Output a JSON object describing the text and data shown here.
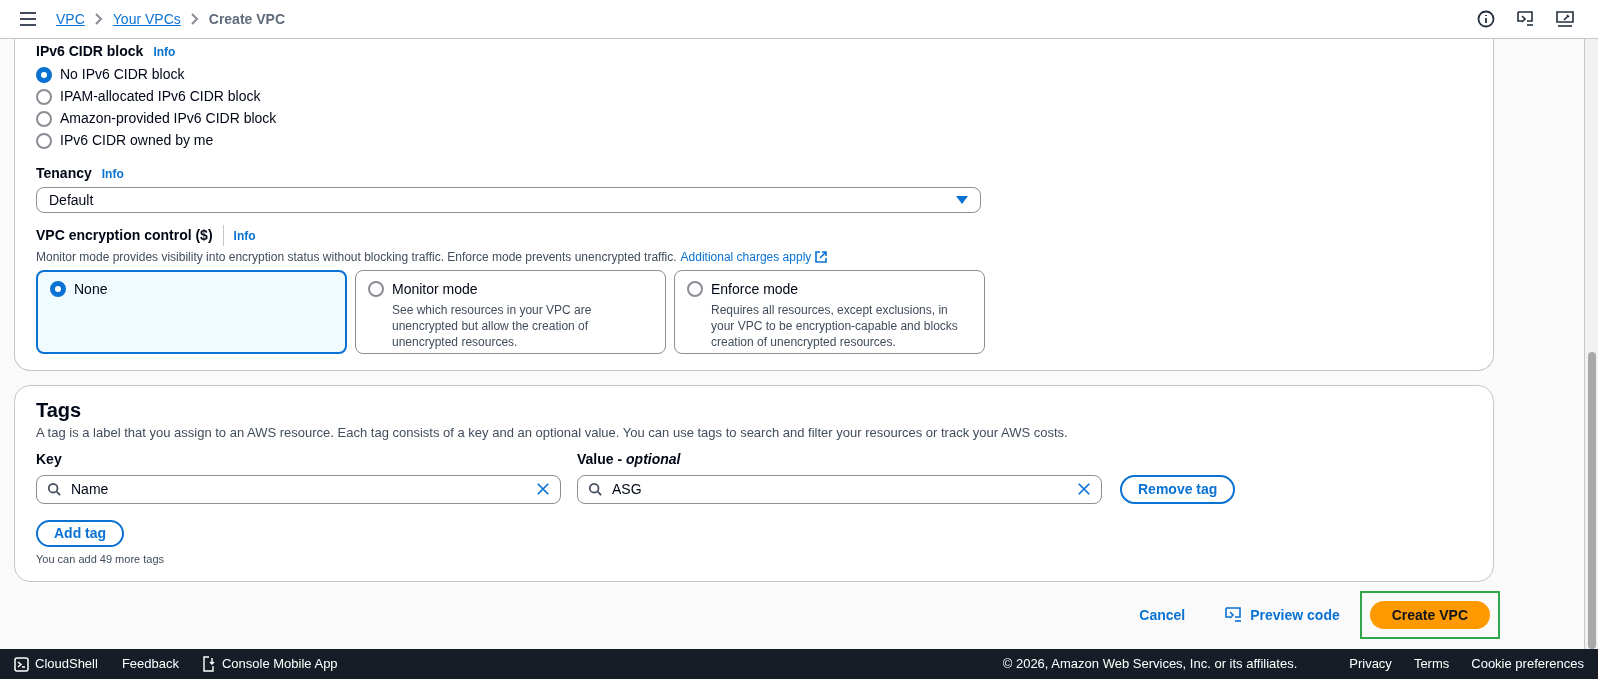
{
  "header": {
    "breadcrumbs": [
      {
        "label": "VPC",
        "kind": "link"
      },
      {
        "label": "Your VPCs",
        "kind": "link"
      },
      {
        "label": "Create VPC",
        "kind": "current"
      }
    ]
  },
  "ipv6": {
    "label": "IPv6 CIDR block",
    "info": "Info",
    "options": [
      {
        "label": "No IPv6 CIDR block",
        "selected": true
      },
      {
        "label": "IPAM-allocated IPv6 CIDR block",
        "selected": false
      },
      {
        "label": "Amazon-provided IPv6 CIDR block",
        "selected": false
      },
      {
        "label": "IPv6 CIDR owned by me",
        "selected": false
      }
    ]
  },
  "tenancy": {
    "label": "Tenancy",
    "info": "Info",
    "value": "Default"
  },
  "encryption": {
    "label": "VPC encryption control ($)",
    "info": "Info",
    "description": "Monitor mode provides visibility into encryption status without blocking traffic. Enforce mode prevents unencrypted traffic.",
    "link": "Additional charges apply",
    "options": [
      {
        "label": "None",
        "selected": true
      },
      {
        "label": "Monitor mode",
        "description": "See which resources in your VPC are unencrypted but allow the creation of unencrypted resources.",
        "selected": false
      },
      {
        "label": "Enforce mode",
        "description": "Requires all resources, except exclusions, in your VPC to be encryption-capable and blocks creation of unencrypted resources.",
        "selected": false
      }
    ]
  },
  "tags": {
    "title": "Tags",
    "description": "A tag is a label that you assign to an AWS resource. Each tag consists of a key and an optional value. You can use tags to search and filter your resources or track your AWS costs.",
    "key_label": "Key",
    "value_label": "Value - *optional*",
    "rows": [
      {
        "key": "Name",
        "value": "ASG",
        "remove": "Remove tag"
      }
    ],
    "add": "Add tag",
    "hint": "You can add 49 more tags"
  },
  "actions": {
    "cancel": "Cancel",
    "preview": "Preview code",
    "create": "Create VPC"
  },
  "footer": {
    "left": [
      {
        "label": "CloudShell",
        "kind": "cloudshell"
      },
      {
        "label": "Feedback",
        "kind": "plain"
      },
      {
        "label": "Console Mobile App",
        "kind": "mobile"
      }
    ],
    "copyright": "© 2026, Amazon Web Services, Inc. or its affiliates.",
    "links": [
      "Privacy",
      "Terms",
      "Cookie preferences"
    ]
  }
}
